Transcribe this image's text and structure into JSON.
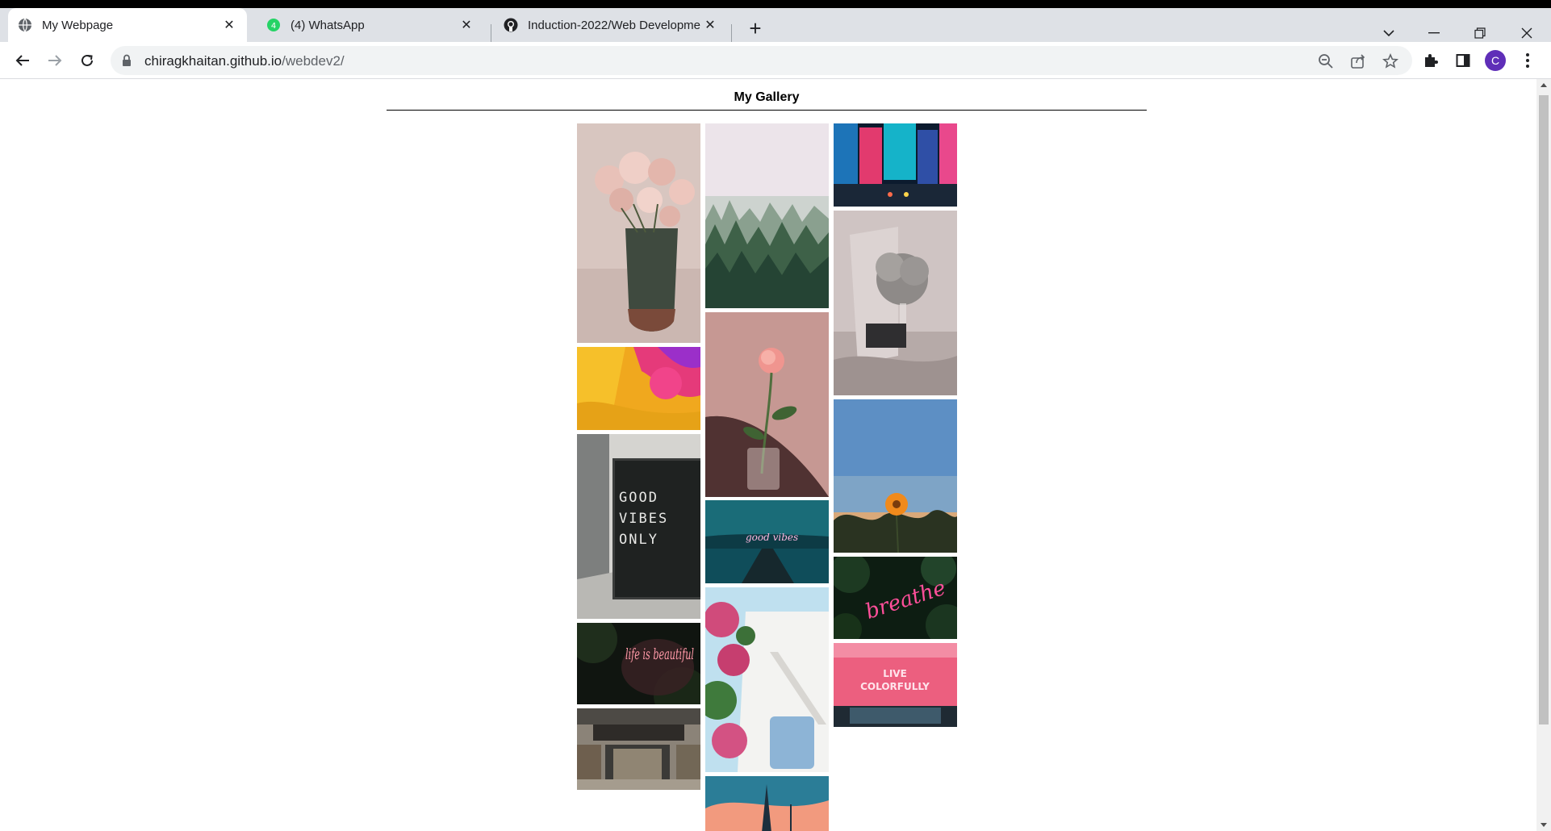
{
  "browser": {
    "tabs": [
      {
        "title": "My Webpage",
        "icon": "globe-icon",
        "active": true
      },
      {
        "title": "(4) WhatsApp",
        "icon": "whatsapp-icon",
        "active": false
      },
      {
        "title": "Induction-2022/Web Developme",
        "icon": "github-icon",
        "active": false
      }
    ],
    "url_host": "chiragkhaitan.github.io",
    "url_path": "/webdev2/",
    "profile_initial": "C",
    "colors": {
      "tabstrip": "#dee1e6",
      "avatar": "#5f2eb8",
      "whatsapp": "#25d366"
    }
  },
  "page": {
    "title": "My Gallery",
    "images": [
      {
        "subject": "roses-in-vase"
      },
      {
        "subject": "abstract-paint"
      },
      {
        "subject": "good-vibes-only-sign",
        "sign_text": [
          "GOOD",
          "VIBES",
          "ONLY"
        ]
      },
      {
        "subject": "life-is-beautiful-neon",
        "sign_text": "life is beautiful"
      },
      {
        "subject": "storefront"
      },
      {
        "subject": "misty-forest"
      },
      {
        "subject": "single-rose"
      },
      {
        "subject": "pier-sunset",
        "sign_text": "good vibes"
      },
      {
        "subject": "white-stairs-bougainvillea"
      },
      {
        "subject": "tower-sunset"
      },
      {
        "subject": "city-night"
      },
      {
        "subject": "dried-flowers-bedroom"
      },
      {
        "subject": "orange-flower-sky"
      },
      {
        "subject": "breathe-neon",
        "sign_text": "breathe"
      },
      {
        "subject": "live-colorfully-neon",
        "sign_text": [
          "LIVE",
          "COLORFULLY"
        ]
      }
    ]
  }
}
